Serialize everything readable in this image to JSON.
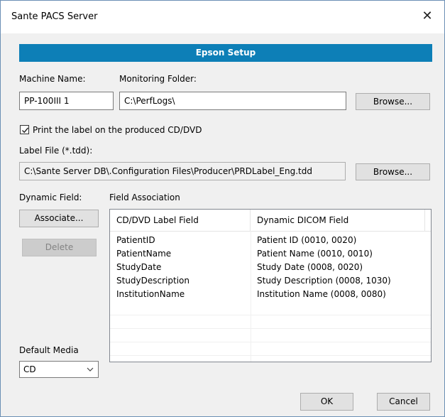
{
  "window": {
    "title": "Sante PACS Server",
    "close_glyph": "✕"
  },
  "banner": {
    "title": "Epson Setup",
    "color": "#0d7fb7"
  },
  "machine": {
    "label": "Machine Name:",
    "value": "PP-100III 1"
  },
  "monitor": {
    "label": "Monitoring Folder:",
    "value": "C:\\PerfLogs\\",
    "browse": "Browse..."
  },
  "print_label": {
    "checked": true,
    "label": "Print the label on the produced CD/DVD"
  },
  "label_file": {
    "label": "Label File (*.tdd):",
    "value": "C:\\Sante Server DB\\.Configuration Files\\Producer\\PRDLabel_Eng.tdd",
    "browse": "Browse..."
  },
  "dynamic": {
    "label": "Dynamic Field:",
    "associate": "Associate...",
    "delete": "Delete"
  },
  "association": {
    "label": "Field Association",
    "columns": [
      "CD/DVD Label Field",
      "Dynamic DICOM Field"
    ],
    "rows": [
      [
        "PatientID",
        "Patient ID (0010, 0020)"
      ],
      [
        "PatientName",
        "Patient Name (0010, 0010)"
      ],
      [
        "StudyDate",
        "Study Date (0008, 0020)"
      ],
      [
        "StudyDescription",
        "Study Description (0008, 1030)"
      ],
      [
        "InstitutionName",
        "Institution Name (0008, 0080)"
      ]
    ]
  },
  "media": {
    "label": "Default Media",
    "value": "CD"
  },
  "footer": {
    "ok": "OK",
    "cancel": "Cancel"
  }
}
